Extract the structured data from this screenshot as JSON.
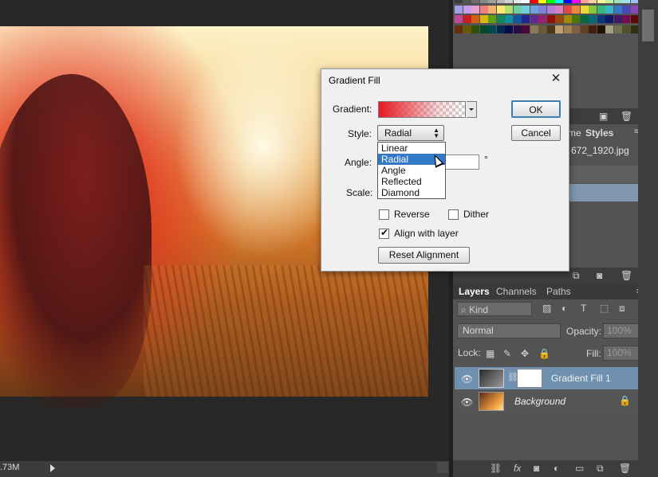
{
  "document": {
    "size_status": ".73M"
  },
  "dialog": {
    "title": "Gradient Fill",
    "gradient_label": "Gradient:",
    "style_label": "Style:",
    "style_value": "Radial",
    "angle_label": "Angle:",
    "angle_unit": "°",
    "scale_label": "Scale:",
    "style_options": [
      "Linear",
      "Radial",
      "Angle",
      "Reflected",
      "Diamond"
    ],
    "selected_option": "Radial",
    "reverse_label": "Reverse",
    "reverse_checked": false,
    "dither_label": "Dither",
    "dither_checked": false,
    "align_label": "Align with layer",
    "align_checked": true,
    "reset_label": "Reset Alignment",
    "ok_label": "OK",
    "cancel_label": "Cancel",
    "gradient_start_color": "#e6192a"
  },
  "panels": {
    "upper_tab_partial": "me",
    "styles_tab": "Styles",
    "history_file": "672_1920.jpg",
    "layers_tabs": [
      "Layers",
      "Channels",
      "Paths"
    ],
    "kind_filter": "Kind",
    "blend_mode": "Normal",
    "opacity_label": "Opacity:",
    "opacity_value": "100%",
    "lock_label": "Lock:",
    "fill_label": "Fill:",
    "fill_value": "100%",
    "layers": [
      {
        "name": "Gradient Fill 1",
        "selected": true
      },
      {
        "name": "Background",
        "locked": true
      }
    ]
  }
}
